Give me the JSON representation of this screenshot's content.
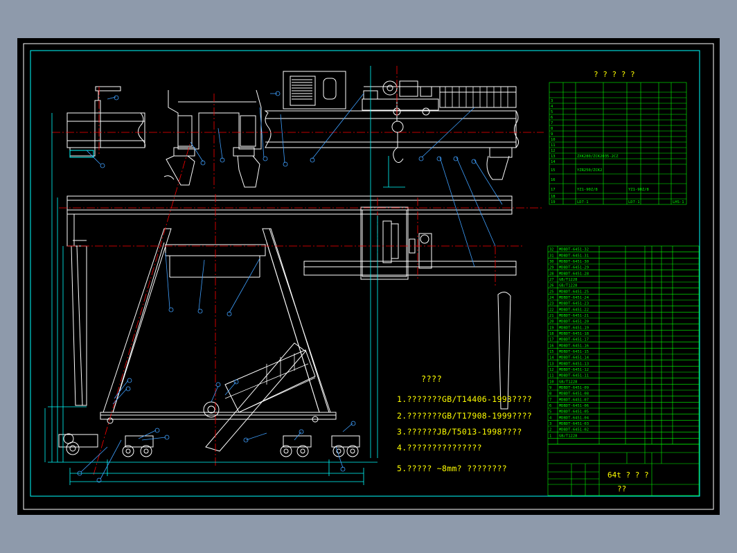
{
  "parameter_table": {
    "title": "? ? ? ? ?"
  },
  "notes": {
    "heading": "????",
    "items": [
      "1.???????GB/T14406-1993????",
      "2.???????GB/T17908-1999????",
      "3.??????JB/T5013-1998????",
      "4.???????????????",
      "5.?????  ~8mm? ????????"
    ]
  },
  "parts_list": {
    "rows": [
      {
        "no": "32",
        "code": "MDBDT-6451-32"
      },
      {
        "no": "31",
        "code": "MDBDT-6451-31"
      },
      {
        "no": "30",
        "code": "MDBDT-6451-30"
      },
      {
        "no": "29",
        "code": "MDBDT-6451-29"
      },
      {
        "no": "28",
        "code": "MDBDT-6451-28"
      },
      {
        "no": "27",
        "code": "GB/T1228"
      },
      {
        "no": "26",
        "code": "GB/T1228"
      },
      {
        "no": "25",
        "code": "MDBDT-6451-25"
      },
      {
        "no": "24",
        "code": "MDBDT-6451-24"
      },
      {
        "no": "23",
        "code": "MDBDT-6451-23"
      },
      {
        "no": "22",
        "code": "MDBDT-6451-22"
      },
      {
        "no": "21",
        "code": "MDBDT-6451-21"
      },
      {
        "no": "20",
        "code": "MDBDT-6451-20"
      },
      {
        "no": "19",
        "code": "MDBDT-6451-19"
      },
      {
        "no": "18",
        "code": "MDBDT-6451-18"
      },
      {
        "no": "17",
        "code": "MDBDT-6451-17"
      },
      {
        "no": "16",
        "code": "MDBDT-6451-16"
      },
      {
        "no": "15",
        "code": "MDBDT-6451-15"
      },
      {
        "no": "14",
        "code": "MDBDT-6451-14"
      },
      {
        "no": "13",
        "code": "MDBDT-6451-13"
      },
      {
        "no": "12",
        "code": "MDBDT-6451-12"
      },
      {
        "no": "11",
        "code": "MDBDT-6451-11"
      },
      {
        "no": "10",
        "code": "GB/T1228"
      },
      {
        "no": "9",
        "code": "MDBDT-6451-09"
      },
      {
        "no": "8",
        "code": "MDBDT-6451-08"
      },
      {
        "no": "7",
        "code": "MDBDT-6451-07"
      },
      {
        "no": "6",
        "code": "MDBDT-6451-06"
      },
      {
        "no": "5",
        "code": "MDBDT-6451-05"
      },
      {
        "no": "4",
        "code": "MDBDT-6451-04"
      },
      {
        "no": "3",
        "code": "MDBDT-6451-03"
      },
      {
        "no": "2",
        "code": "MDBDT-6451-02"
      },
      {
        "no": "1",
        "code": "GB/T1228"
      }
    ]
  },
  "title_block": {
    "drawing_title": "64t ? ? ?",
    "sub_label": "??"
  }
}
